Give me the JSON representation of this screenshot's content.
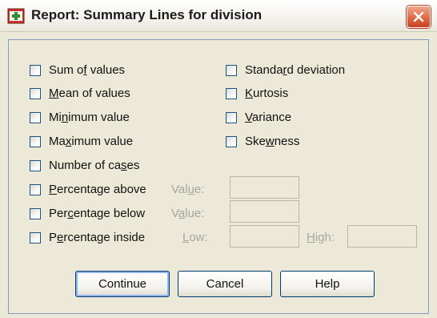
{
  "window": {
    "title": "Report: Summary Lines for division"
  },
  "icons": {
    "title_icon": "spss-report-icon",
    "close_icon": "close-icon"
  },
  "left_options": [
    {
      "pre": "Sum o",
      "u": "f",
      "post": " values"
    },
    {
      "pre": "",
      "u": "M",
      "post": "ean of values"
    },
    {
      "pre": "Mi",
      "u": "n",
      "post": "imum value"
    },
    {
      "pre": "Ma",
      "u": "x",
      "post": "imum value"
    },
    {
      "pre": "Number of ca",
      "u": "s",
      "post": "es"
    }
  ],
  "right_options": [
    {
      "pre": "Standa",
      "u": "r",
      "post": "d deviation"
    },
    {
      "pre": "",
      "u": "K",
      "post": "urtosis"
    },
    {
      "pre": "",
      "u": "V",
      "post": "ariance"
    },
    {
      "pre": "Ske",
      "u": "w",
      "post": "ness"
    }
  ],
  "percentage_options": [
    {
      "pre": "",
      "u": "P",
      "post": "ercentage above",
      "field_label": {
        "pre": "Val",
        "u": "u",
        "post": "e:"
      }
    },
    {
      "pre": "Per",
      "u": "c",
      "post": "entage below",
      "field_label": {
        "pre": "V",
        "u": "a",
        "post": "lue:"
      }
    },
    {
      "pre": "P",
      "u": "e",
      "post": "rcentage inside",
      "field_label": {
        "pre": "",
        "u": "L",
        "post": "ow:"
      },
      "second_field_label": {
        "pre": "",
        "u": "H",
        "post": "igh:"
      }
    }
  ],
  "buttons": {
    "continue": "Continue",
    "cancel": "Cancel",
    "help": "Help"
  },
  "colors": {
    "dialog_bg": "#ece9d8",
    "close_red": "#e36a45",
    "border_blue": "#7f9db9",
    "disabled_text": "#a7a7a1"
  }
}
